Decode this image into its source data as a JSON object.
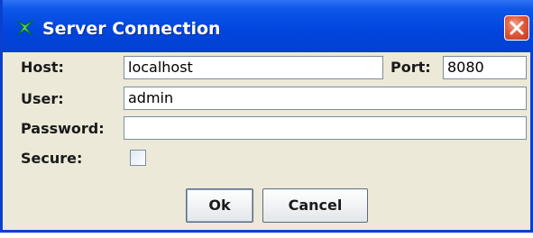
{
  "window": {
    "title": "Server Connection"
  },
  "form": {
    "host": {
      "label": "Host:",
      "value": "localhost"
    },
    "port": {
      "label": "Port:",
      "value": "8080"
    },
    "user": {
      "label": "User:",
      "value": "admin"
    },
    "password": {
      "label": "Password:",
      "value": ""
    },
    "secure": {
      "label": "Secure:",
      "checked": false
    }
  },
  "buttons": {
    "ok": "Ok",
    "cancel": "Cancel"
  },
  "colors": {
    "title_bar": "#0045dd",
    "window_bg": "#ece9d8",
    "close_button": "#e05a3a"
  }
}
